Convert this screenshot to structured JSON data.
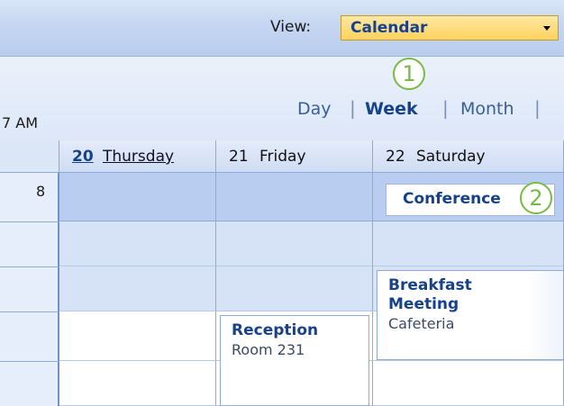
{
  "toolbar": {
    "view_label": "View:",
    "view_value": "Calendar"
  },
  "nav": {
    "callout_1": "1",
    "callout_2": "2",
    "scopes": [
      "Day",
      "Week",
      "Month"
    ],
    "separator": "|"
  },
  "days": [
    {
      "num": "20",
      "name": "Thursday"
    },
    {
      "num": "21",
      "name": "Friday"
    },
    {
      "num": "22",
      "name": "Saturday"
    }
  ],
  "times": [
    "7 AM",
    "8"
  ],
  "events": {
    "conference": {
      "title": "Conference"
    },
    "breakfast": {
      "title": "Breakfast Meeting",
      "location": "Cafeteria"
    },
    "reception": {
      "title": "Reception",
      "location": "Room 231"
    }
  },
  "colors": {
    "accent": "#15428b",
    "callout": "#77bb44",
    "select_bg": "#ffd25e"
  }
}
